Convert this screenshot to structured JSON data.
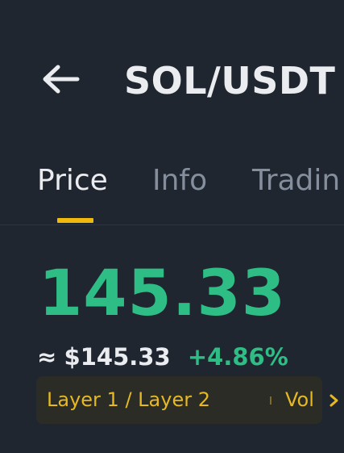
{
  "header": {
    "back_icon": "arrow-left-icon",
    "pair": "SOL/USDT"
  },
  "tabs": [
    {
      "label": "Price",
      "active": true
    },
    {
      "label": "Info",
      "active": false
    },
    {
      "label": "Tradin",
      "active": false
    }
  ],
  "ticker": {
    "price": "145.33",
    "approx_symbol": "≈",
    "fiat_price": "$145.33",
    "change_pct": "+4.86%"
  },
  "tags": {
    "category": "Layer 1 / Layer 2",
    "vol_label": "Vol",
    "chevron_icon": "chevron-right-icon"
  },
  "colors": {
    "background": "#1f2630",
    "accent": "#f0b90b",
    "positive": "#2ebd85",
    "muted": "#848e9c",
    "tag_text": "#e5b824"
  }
}
